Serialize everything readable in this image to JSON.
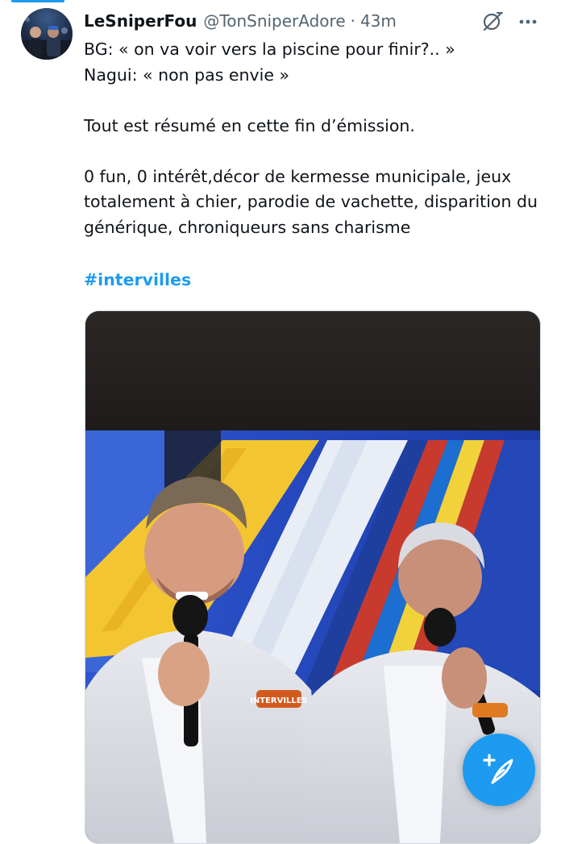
{
  "tweet": {
    "display_name": "LeSniperFou",
    "handle": "@TonSniperAdore",
    "separator": "·",
    "time": "43m",
    "text": "BG: « on va voir vers la piscine pour finir?.. »\nNagui: « non pas envie »\n\nTout est résumé en cette fin d’émission.\n\n0 fun, 0 intérêt,décor de kermesse municipale, jeux totalement à chier, parodie de vachette, disparition du générique, chroniqueurs sans charisme",
    "hashtag": "#intervilles"
  },
  "media": {
    "jacket_logo_text": "INTERVILLES"
  },
  "icons": {
    "grok": "grok-icon",
    "more": "more-icon",
    "compose": "compose-icon"
  },
  "colors": {
    "accent": "#1d9bf0",
    "text_primary": "#0f1419",
    "text_secondary": "#536471"
  }
}
